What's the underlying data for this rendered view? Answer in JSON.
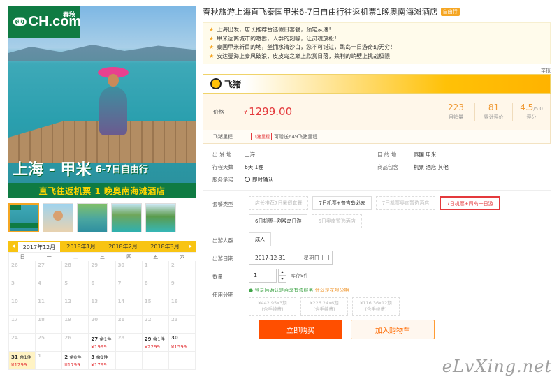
{
  "hero": {
    "logo_text": "CH.com",
    "logo_cn": "春秋",
    "banner_big": "上海 - 甲米",
    "banner_small": "6-7日自由行",
    "banner_sub": "直飞往返机票 1 晚奥南海滩酒店"
  },
  "calendar": {
    "months": [
      "2017年12月",
      "2018年1月",
      "2018年2月",
      "2018年3月"
    ],
    "active_month": "2017年12月",
    "weekdays": [
      "日",
      "一",
      "二",
      "三",
      "四",
      "五",
      "六"
    ],
    "rows": [
      [
        {
          "d": "26"
        },
        {
          "d": "27"
        },
        {
          "d": "28"
        },
        {
          "d": "29"
        },
        {
          "d": "30"
        },
        {
          "d": "1"
        },
        {
          "d": "2"
        }
      ],
      [
        {
          "d": "3"
        },
        {
          "d": "4"
        },
        {
          "d": "5"
        },
        {
          "d": "6"
        },
        {
          "d": "7"
        },
        {
          "d": "8"
        },
        {
          "d": "9"
        }
      ],
      [
        {
          "d": "10"
        },
        {
          "d": "11"
        },
        {
          "d": "12"
        },
        {
          "d": "13"
        },
        {
          "d": "14"
        },
        {
          "d": "15"
        },
        {
          "d": "16"
        }
      ],
      [
        {
          "d": "17"
        },
        {
          "d": "18"
        },
        {
          "d": "19"
        },
        {
          "d": "20"
        },
        {
          "d": "21"
        },
        {
          "d": "22"
        },
        {
          "d": "23"
        }
      ],
      [
        {
          "d": "24"
        },
        {
          "d": "25"
        },
        {
          "d": "26"
        },
        {
          "d": "27",
          "rem": "余1件",
          "price": "¥1999",
          "av": true
        },
        {
          "d": "28"
        },
        {
          "d": "29",
          "rem": "余1件",
          "price": "¥2299",
          "av": true
        },
        {
          "d": "30",
          "price": "¥1599",
          "av": true
        }
      ],
      [
        {
          "d": "31",
          "rem": "余1件",
          "price": "¥1299",
          "av": true,
          "hl": true
        },
        {
          "d": "1"
        },
        {
          "d": "2",
          "rem": "余8件",
          "price": "¥1799",
          "av": true
        },
        {
          "d": "3",
          "rem": "余1件",
          "price": "¥1799",
          "av": true
        },
        {
          "d": ""
        },
        {
          "d": ""
        },
        {
          "d": ""
        }
      ]
    ]
  },
  "product": {
    "title": "春秋旅游上海直飞泰国甲米6-7日自由行往返机票1晚奥南海滩酒店",
    "tag": "自由行",
    "bullets": [
      "上海出发，店长推荐暂选假日套餐，预定从速！",
      "甲米远离城市的喧嚣，人群的刻噪，让灵魂放松！",
      "泰国甲米新目的地，坐拥水清沙白，您不可错过，跳岛一日游奇幻无穷！",
      "安达曼海上泰风破浪，皮皮岛之巅上欣赏日落，莱利的峭壁上挑战极限"
    ],
    "report": "举报"
  },
  "feizhu": {
    "brand": "飞猪"
  },
  "price": {
    "label": "价格",
    "currency": "¥",
    "amount": "1299.00",
    "stats": [
      {
        "value": "223",
        "sub": "",
        "label": "月销量"
      },
      {
        "value": "81",
        "sub": "",
        "label": "累计评价"
      },
      {
        "value": "4.5",
        "sub": "/5.0",
        "label": "评分"
      }
    ]
  },
  "mileage": {
    "label": "飞猪里程",
    "badge": "飞猪里程",
    "text": "可赠送649飞猪里程"
  },
  "info": {
    "depart_label": "出 发 地",
    "depart": "上海",
    "dest_label": "目 的 地",
    "dest": "泰国  甲米",
    "days_label": "行程天数",
    "days": "6天  1晚",
    "incl_label": "商品包含",
    "incl": "机票  酒店  其他",
    "svc_label": "服务承诺",
    "svc": "即时确认"
  },
  "options": {
    "package_label": "套餐类型",
    "packages": [
      {
        "label": "店长推荐7日暑假套餐",
        "state": "dis"
      },
      {
        "label": "7日机票+普吉岛必去",
        "state": "on"
      },
      {
        "label": "7日机票奥南暂选酒店",
        "state": "dis"
      },
      {
        "label": "7日机票+四岛一日游",
        "state": "sel"
      },
      {
        "label": "6日机票+割喉岛日游",
        "state": "on"
      },
      {
        "label": "6日奥南暂选酒店",
        "state": "dis"
      }
    ],
    "people_label": "出游人群",
    "people": "成人",
    "date_label": "出游日期",
    "date": "2017-12-31",
    "weekday": "星期日",
    "qty_label": "数量",
    "qty": "1",
    "stock": "库存9件",
    "inst_label": "使用分期",
    "inst_text": "登录后确认是否享有该服务",
    "inst_link": "什么是花呗分期",
    "plans": [
      {
        "amt": "¥442.95x3期",
        "fee": "(含手续费)"
      },
      {
        "amt": "¥226.24x6期",
        "fee": "(含手续费)"
      },
      {
        "amt": "¥116.36x12期",
        "fee": "(含手续费)"
      }
    ]
  },
  "actions": {
    "buy": "立即购买",
    "cart": "加入购物车"
  },
  "watermark": "eLvXing.net"
}
